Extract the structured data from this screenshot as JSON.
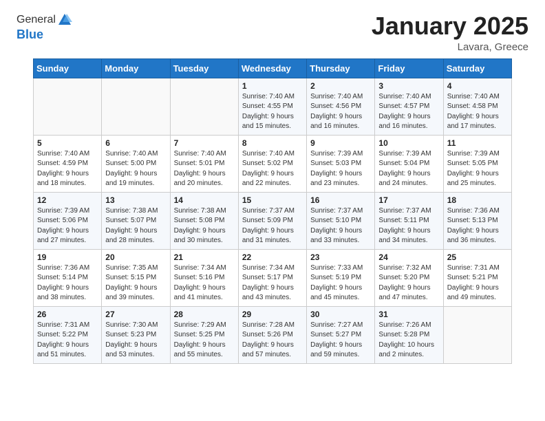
{
  "logo": {
    "general": "General",
    "blue": "Blue"
  },
  "title": "January 2025",
  "location": "Lavara, Greece",
  "days_header": [
    "Sunday",
    "Monday",
    "Tuesday",
    "Wednesday",
    "Thursday",
    "Friday",
    "Saturday"
  ],
  "weeks": [
    [
      {
        "num": "",
        "info": ""
      },
      {
        "num": "",
        "info": ""
      },
      {
        "num": "",
        "info": ""
      },
      {
        "num": "1",
        "info": "Sunrise: 7:40 AM\nSunset: 4:55 PM\nDaylight: 9 hours\nand 15 minutes."
      },
      {
        "num": "2",
        "info": "Sunrise: 7:40 AM\nSunset: 4:56 PM\nDaylight: 9 hours\nand 16 minutes."
      },
      {
        "num": "3",
        "info": "Sunrise: 7:40 AM\nSunset: 4:57 PM\nDaylight: 9 hours\nand 16 minutes."
      },
      {
        "num": "4",
        "info": "Sunrise: 7:40 AM\nSunset: 4:58 PM\nDaylight: 9 hours\nand 17 minutes."
      }
    ],
    [
      {
        "num": "5",
        "info": "Sunrise: 7:40 AM\nSunset: 4:59 PM\nDaylight: 9 hours\nand 18 minutes."
      },
      {
        "num": "6",
        "info": "Sunrise: 7:40 AM\nSunset: 5:00 PM\nDaylight: 9 hours\nand 19 minutes."
      },
      {
        "num": "7",
        "info": "Sunrise: 7:40 AM\nSunset: 5:01 PM\nDaylight: 9 hours\nand 20 minutes."
      },
      {
        "num": "8",
        "info": "Sunrise: 7:40 AM\nSunset: 5:02 PM\nDaylight: 9 hours\nand 22 minutes."
      },
      {
        "num": "9",
        "info": "Sunrise: 7:39 AM\nSunset: 5:03 PM\nDaylight: 9 hours\nand 23 minutes."
      },
      {
        "num": "10",
        "info": "Sunrise: 7:39 AM\nSunset: 5:04 PM\nDaylight: 9 hours\nand 24 minutes."
      },
      {
        "num": "11",
        "info": "Sunrise: 7:39 AM\nSunset: 5:05 PM\nDaylight: 9 hours\nand 25 minutes."
      }
    ],
    [
      {
        "num": "12",
        "info": "Sunrise: 7:39 AM\nSunset: 5:06 PM\nDaylight: 9 hours\nand 27 minutes."
      },
      {
        "num": "13",
        "info": "Sunrise: 7:38 AM\nSunset: 5:07 PM\nDaylight: 9 hours\nand 28 minutes."
      },
      {
        "num": "14",
        "info": "Sunrise: 7:38 AM\nSunset: 5:08 PM\nDaylight: 9 hours\nand 30 minutes."
      },
      {
        "num": "15",
        "info": "Sunrise: 7:37 AM\nSunset: 5:09 PM\nDaylight: 9 hours\nand 31 minutes."
      },
      {
        "num": "16",
        "info": "Sunrise: 7:37 AM\nSunset: 5:10 PM\nDaylight: 9 hours\nand 33 minutes."
      },
      {
        "num": "17",
        "info": "Sunrise: 7:37 AM\nSunset: 5:11 PM\nDaylight: 9 hours\nand 34 minutes."
      },
      {
        "num": "18",
        "info": "Sunrise: 7:36 AM\nSunset: 5:13 PM\nDaylight: 9 hours\nand 36 minutes."
      }
    ],
    [
      {
        "num": "19",
        "info": "Sunrise: 7:36 AM\nSunset: 5:14 PM\nDaylight: 9 hours\nand 38 minutes."
      },
      {
        "num": "20",
        "info": "Sunrise: 7:35 AM\nSunset: 5:15 PM\nDaylight: 9 hours\nand 39 minutes."
      },
      {
        "num": "21",
        "info": "Sunrise: 7:34 AM\nSunset: 5:16 PM\nDaylight: 9 hours\nand 41 minutes."
      },
      {
        "num": "22",
        "info": "Sunrise: 7:34 AM\nSunset: 5:17 PM\nDaylight: 9 hours\nand 43 minutes."
      },
      {
        "num": "23",
        "info": "Sunrise: 7:33 AM\nSunset: 5:19 PM\nDaylight: 9 hours\nand 45 minutes."
      },
      {
        "num": "24",
        "info": "Sunrise: 7:32 AM\nSunset: 5:20 PM\nDaylight: 9 hours\nand 47 minutes."
      },
      {
        "num": "25",
        "info": "Sunrise: 7:31 AM\nSunset: 5:21 PM\nDaylight: 9 hours\nand 49 minutes."
      }
    ],
    [
      {
        "num": "26",
        "info": "Sunrise: 7:31 AM\nSunset: 5:22 PM\nDaylight: 9 hours\nand 51 minutes."
      },
      {
        "num": "27",
        "info": "Sunrise: 7:30 AM\nSunset: 5:23 PM\nDaylight: 9 hours\nand 53 minutes."
      },
      {
        "num": "28",
        "info": "Sunrise: 7:29 AM\nSunset: 5:25 PM\nDaylight: 9 hours\nand 55 minutes."
      },
      {
        "num": "29",
        "info": "Sunrise: 7:28 AM\nSunset: 5:26 PM\nDaylight: 9 hours\nand 57 minutes."
      },
      {
        "num": "30",
        "info": "Sunrise: 7:27 AM\nSunset: 5:27 PM\nDaylight: 9 hours\nand 59 minutes."
      },
      {
        "num": "31",
        "info": "Sunrise: 7:26 AM\nSunset: 5:28 PM\nDaylight: 10 hours\nand 2 minutes."
      },
      {
        "num": "",
        "info": ""
      }
    ]
  ]
}
